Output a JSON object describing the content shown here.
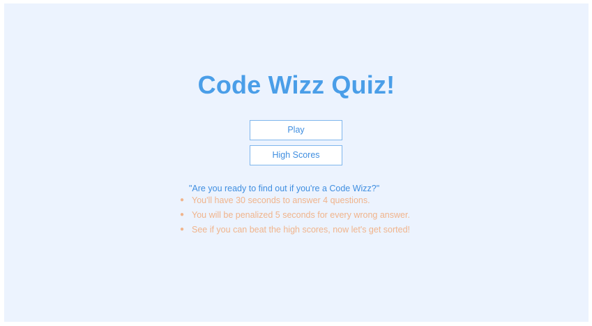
{
  "page": {
    "title": "Code Wizz Quiz!",
    "background_color": "#ecf3fe",
    "accent_color": "#4a9ee8",
    "rule_color": "#f0b48c"
  },
  "menu": {
    "play_label": "Play",
    "high_scores_label": "High Scores"
  },
  "intro": {
    "question": "\"Are you ready to find out if you're a Code Wizz?\""
  },
  "rules": {
    "bullet_icon": "bullet-dot",
    "items": [
      "You'll have 30 seconds to answer 4 questions.",
      "You will be penalized 5 seconds for every wrong answer.",
      "See if you can beat the high scores, now let's get sorted!"
    ]
  }
}
